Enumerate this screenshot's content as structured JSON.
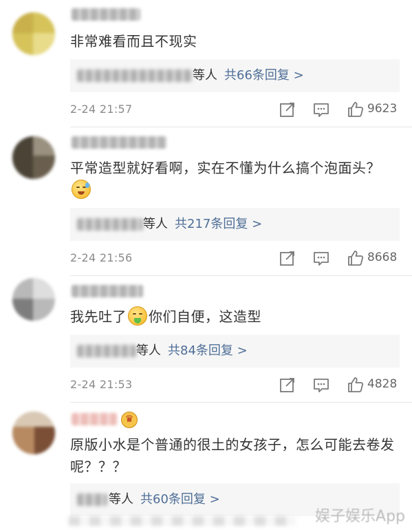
{
  "comments": [
    {
      "text": "非常难看而且不现实",
      "reply_suffix": "等人",
      "reply_count": "共66条回复 >",
      "timestamp": "2-24 21:57",
      "likes": "9623"
    },
    {
      "text": "平常造型就好看啊，实在不懂为什么搞个泡面头？",
      "emoji": "sweat-emoji",
      "reply_suffix": "等人",
      "reply_count": "共217条回复 >",
      "timestamp": "2-24 21:56",
      "likes": "8668"
    },
    {
      "text_before": "我先吐了",
      "emoji": "vomit-emoji",
      "text_after": "你们自便，这造型",
      "reply_suffix": "等人",
      "reply_count": "共84条回复 >",
      "timestamp": "2-24 21:53",
      "likes": "4828"
    },
    {
      "text": "原版小水是个普通的很土的女孩子，怎么可能去卷发呢？？？",
      "badge": "crown-icon",
      "reply_suffix": "等人",
      "reply_count": "共60条回复 >"
    }
  ],
  "icons": {
    "repost": "share-edit-icon",
    "comment": "comment-icon",
    "like": "thumbs-up-icon"
  },
  "colors": {
    "link": "#4e6e96",
    "text": "#333333",
    "meta": "#8a8a8a",
    "reply_bg": "#f6f6f6"
  },
  "watermark": "娱子娱乐App"
}
